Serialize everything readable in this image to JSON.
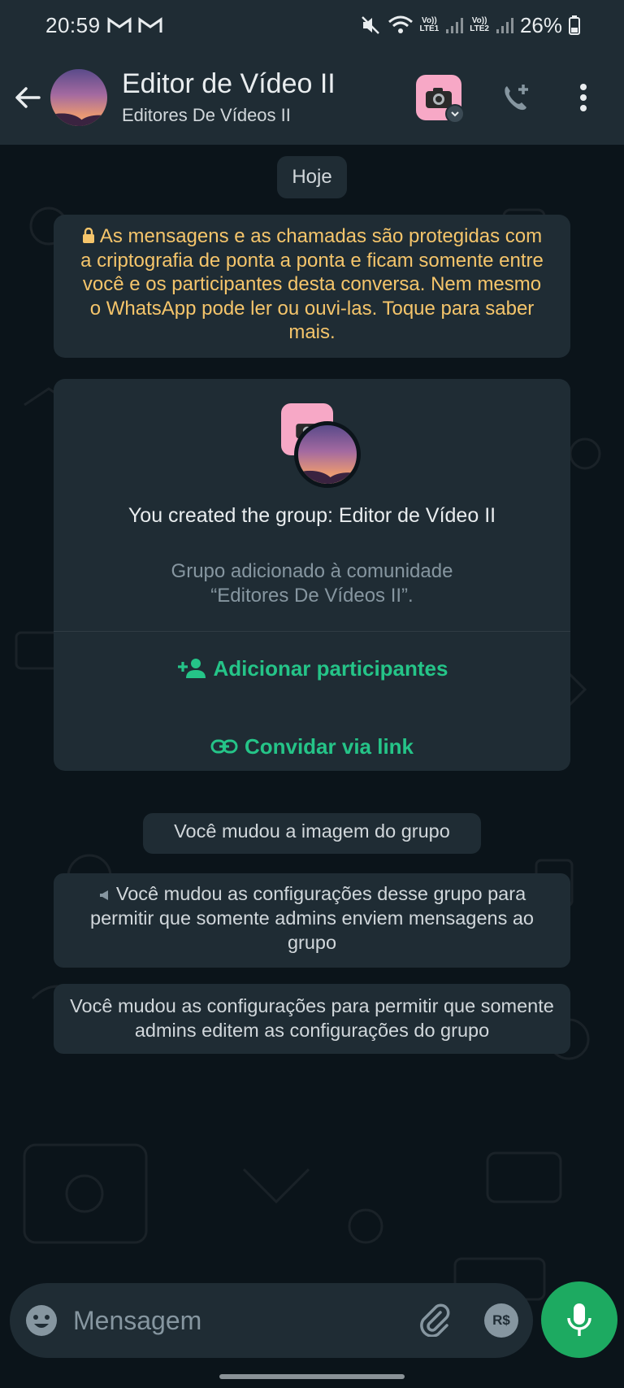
{
  "status_bar": {
    "time": "20:59",
    "battery": "26%",
    "lte1": "LTE1",
    "lte2": "LTE2",
    "vo": "Vo))"
  },
  "header": {
    "title": "Editor de Vídeo II",
    "subtitle": "Editores De Vídeos II"
  },
  "chat": {
    "date_chip": "Hoje",
    "encryption_notice": "As mensagens e as chamadas são protegidas com a criptografia de ponta a ponta e ficam somente entre você e os participantes desta conversa. Nem mesmo o WhatsApp pode ler ou ouvi-las. Toque para saber mais.",
    "group_card": {
      "created_text": "You created the group: Editor de Vídeo II",
      "community_line1": "Grupo adicionado à comunidade",
      "community_line2": "“Editores De Vídeos II”.",
      "add_participants": "Adicionar participantes",
      "invite_link": "Convidar via link"
    },
    "system_messages": [
      "Você mudou a imagem do grupo",
      "Você mudou as configurações desse grupo para permitir que somente admins enviem mensagens ao grupo",
      "Você mudou as configurações para permitir que somente admins editem as configurações do grupo"
    ]
  },
  "composer": {
    "placeholder": "Mensagem",
    "currency_label": "R$"
  },
  "colors": {
    "background": "#0b141a",
    "panel": "#1f2c34",
    "accent_green": "#1daa61",
    "notice_yellow": "#f5c56b",
    "action_green": "#25c488"
  },
  "icons": [
    "back-arrow-icon",
    "camera-icon",
    "add-call-icon",
    "more-vert-icon",
    "lock-icon",
    "add-person-icon",
    "link-icon",
    "megaphone-icon",
    "emoji-icon",
    "attach-icon",
    "rs-payment-icon",
    "camera-icon",
    "mic-icon"
  ]
}
